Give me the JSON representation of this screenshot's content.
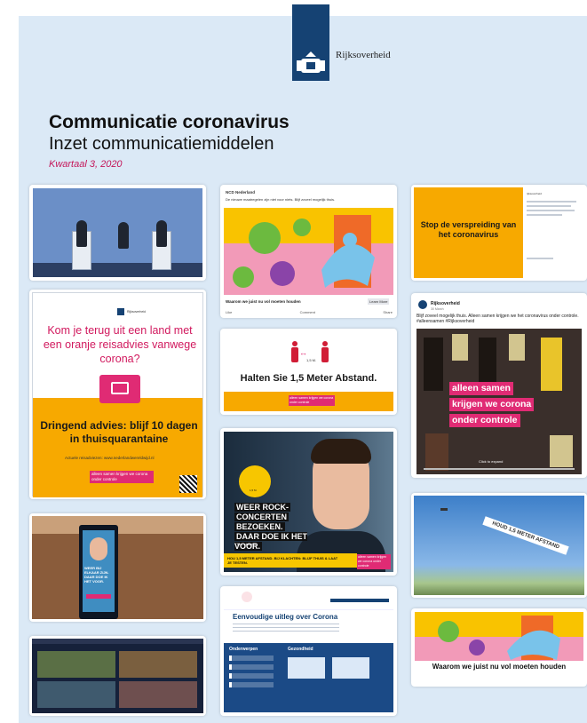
{
  "header": {
    "org": "Rijksoverheid",
    "title": "Communicatie coronavirus",
    "subtitle": "Inzet communicatiemiddelen",
    "period": "Kwartaal 3, 2020"
  },
  "travel_poster": {
    "gov": "Rijksoverheid",
    "question": "Kom je terug uit een land met een oranje reisadvies vanwege corona?",
    "advice": "Dringend advies: blijf 10 dagen in thuisquarantaine",
    "link": "Actuele reisadviezen: www.nederlandwereldwijd.nl",
    "slogan": "alleen samen krijgen we corona onder controle"
  },
  "kiosk": {
    "text": "WEER BIJ ELKAAR ZIJN. DAAR DOE IK HET VOOR."
  },
  "facebook_post": {
    "account": "NCD Nederland",
    "body": "De nieuwe maatregelen zijn niet voor niets. Blijf zoveel mogelijk thuis.",
    "caption": "Waarom we juist nu vol moeten houden",
    "learn_more": "Learn More",
    "actions": [
      "Like",
      "Comment",
      "Share"
    ]
  },
  "distance_poster": {
    "distance": "1,5 M.",
    "text": "Halten Sie 1,5 Meter Abstand.",
    "slogan": "alleen samen krijgen we corona onder controle"
  },
  "student_poster": {
    "sign_text": "1,5 M.",
    "headline_1": "WEER ROCK-",
    "headline_2": "CONCERTEN",
    "headline_3": "BEZOEKEN.",
    "headline_4": "DAAR DOE IK HET VOOR.",
    "byline": "Tim, student",
    "band": "HOU 1,5 METER AFSTAND. BIJ KLACHTEN: BLIJF THUIS & LAAT JE TESTEN.",
    "slogan": "alleen samen krijgen we corona onder controle"
  },
  "website": {
    "heading": "Eenvoudige uitleg over Corona",
    "sidebar_title": "Onderwerpen",
    "section_title": "Gezondheid"
  },
  "social_post": {
    "text": "Stop de verspreiding van het coronavirus",
    "account": "rijksoverheid"
  },
  "instagram_post": {
    "account": "Rijksoverheid",
    "date": "30 March",
    "text": "Blijf zoveel mogelijk thuis. Alleen samen krijgen we het coronavirus onder controle. #alleensamen #Rijksoverheid",
    "line1a": "alleen",
    "line1b": "samen",
    "line2": "krijgen we corona",
    "line3": "onder controle",
    "tap": "Click to expand"
  },
  "sky_banner": {
    "text": "HOUD 1,5 METER AFSTAND"
  },
  "video_thumb": {
    "caption": "Waarom we juist nu vol moeten houden"
  },
  "colors": {
    "navy": "#154273",
    "pink": "#e02b74",
    "yellow": "#f7a900",
    "background": "#dbe9f6"
  }
}
